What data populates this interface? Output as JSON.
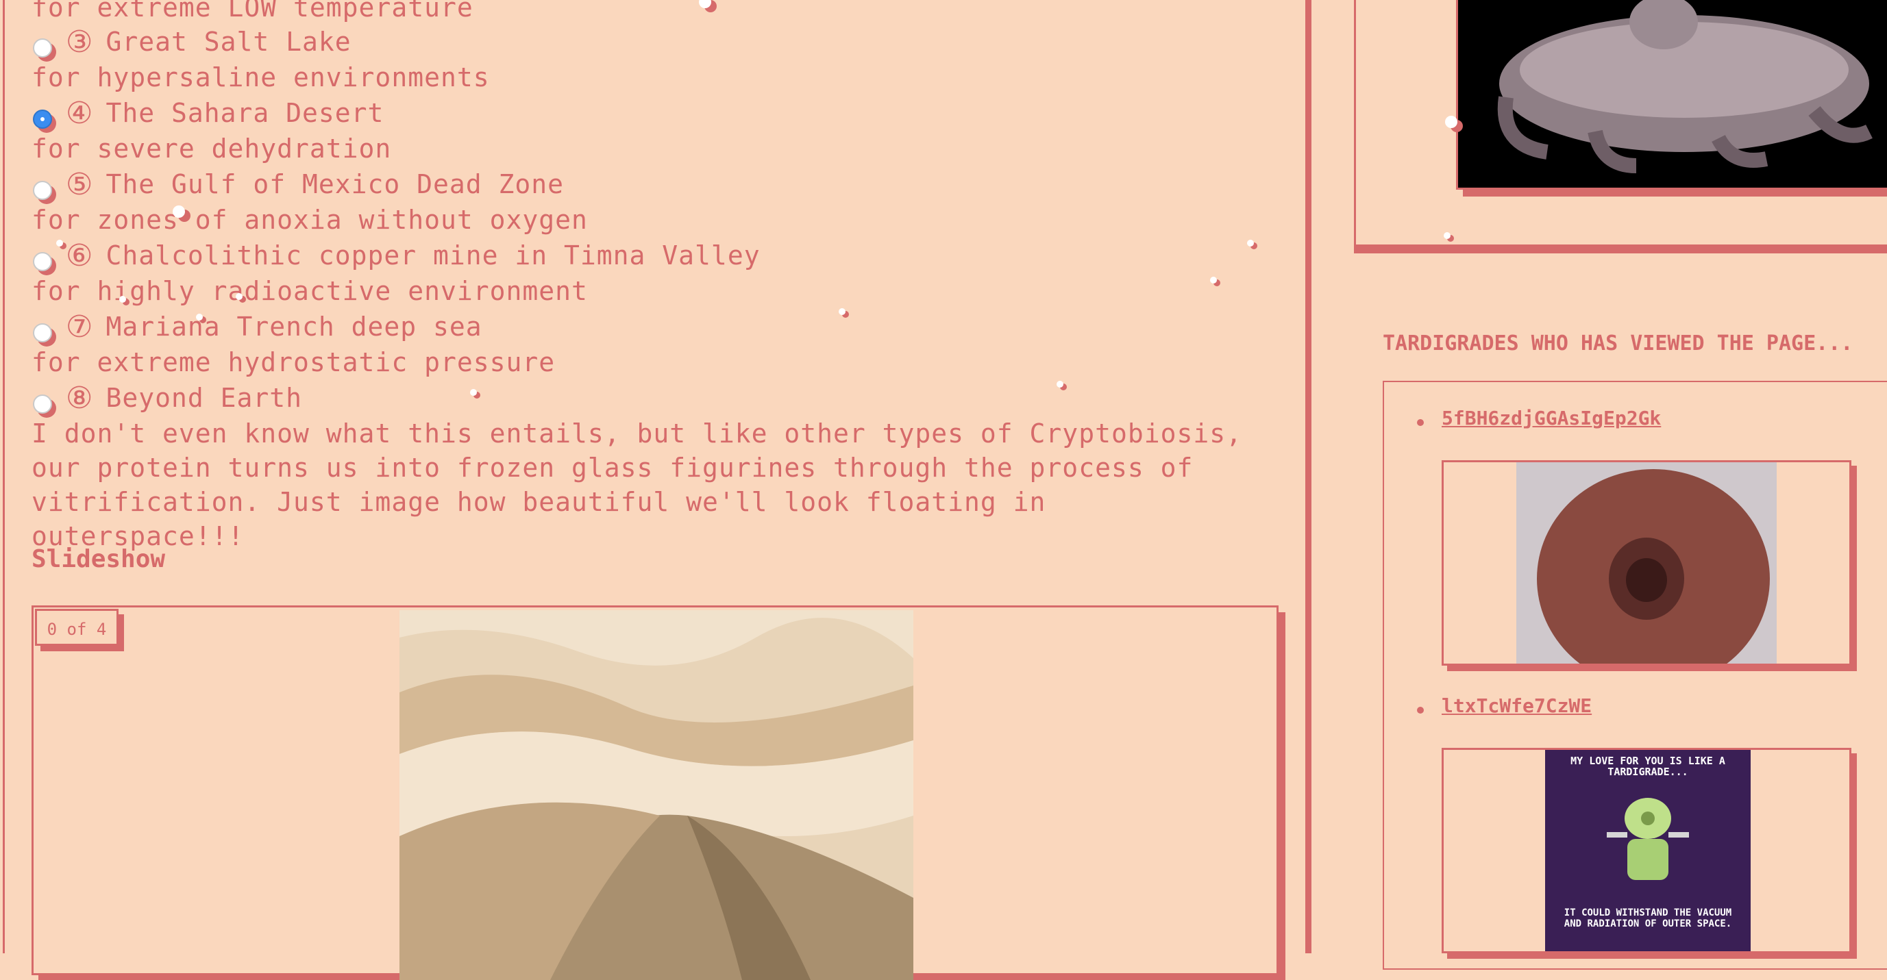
{
  "options": {
    "partial_top": "for extreme LOW temperature",
    "items": [
      {
        "num": "③",
        "title": "Great Salt Lake",
        "desc": "for hypersaline environments",
        "checked": false
      },
      {
        "num": "④",
        "title": "The Sahara Desert",
        "desc": "for severe dehydration",
        "checked": true
      },
      {
        "num": "⑤",
        "title": "The Gulf of Mexico Dead Zone",
        "desc": "for zones of anoxia without oxygen",
        "checked": false
      },
      {
        "num": "⑥",
        "title": "Chalcolithic copper mine in Timna Valley",
        "desc": "for highly radioactive environment",
        "checked": false
      },
      {
        "num": "⑦",
        "title": "Mariana Trench deep sea",
        "desc": "for extreme hydrostatic pressure",
        "checked": false
      },
      {
        "num": "⑧",
        "title": "Beyond Earth",
        "desc": "",
        "checked": false
      }
    ],
    "beyond_paragraph": "I don't even know what this entails, but like other types of Cryptobiosis, our protein turns us into frozen glass figurines through the process of vitrification. Just image how beautiful we'll look floating in outerspace!!!"
  },
  "slideshow": {
    "heading": "Slideshow",
    "counter": "0 of 4"
  },
  "sidebar": {
    "viewers_title": "TARDIGRADES WHO HAS VIEWED THE PAGE...",
    "viewers": [
      {
        "name": "5fBH6zdjGGAsIgEp2Gk"
      },
      {
        "name": "ltxTcWfe7CzWE"
      }
    ],
    "gif_text_top": "MY LOVE FOR YOU IS LIKE A TARDIGRADE...",
    "gif_text_bottom": "IT COULD WITHSTAND THE VACUUM AND RADIATION OF OUTER SPACE."
  },
  "colors": {
    "background": "#fad7bd",
    "accent": "#d66a6a",
    "radio_checked": "#3b8df0"
  }
}
